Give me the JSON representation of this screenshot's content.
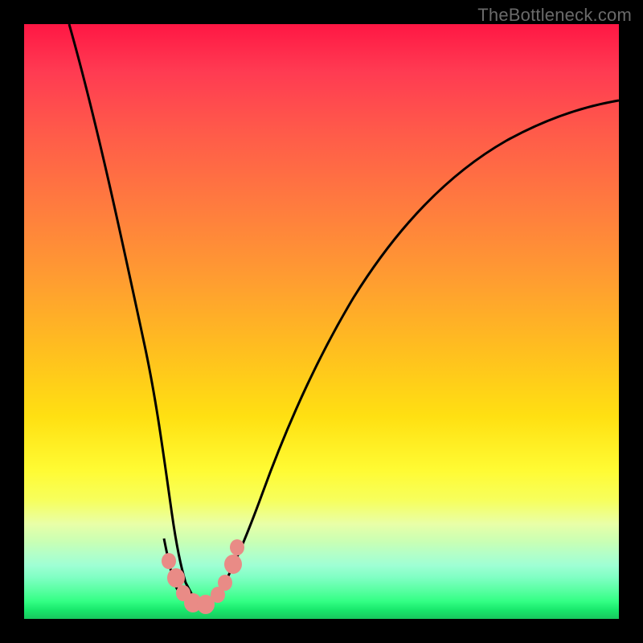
{
  "watermark": "TheBottleneck.com",
  "chart_data": {
    "type": "line",
    "title": "",
    "xlabel": "",
    "ylabel": "",
    "xlim": [
      0,
      1
    ],
    "ylim": [
      0,
      1
    ],
    "note": "Axes are unlabeled; x and y are approximate normalized positions read from the rendered plot. y=0 is the bottom (green) edge, y=1 is the top (red) edge.",
    "series": [
      {
        "name": "bottleneck-curve",
        "x": [
          0.0,
          0.05,
          0.1,
          0.14,
          0.18,
          0.21,
          0.235,
          0.26,
          0.285,
          0.31,
          0.33,
          0.36,
          0.395,
          0.44,
          0.5,
          0.57,
          0.65,
          0.74,
          0.84,
          0.94,
          1.0
        ],
        "y": [
          1.0,
          0.84,
          0.68,
          0.53,
          0.39,
          0.26,
          0.14,
          0.05,
          0.025,
          0.03,
          0.07,
          0.14,
          0.24,
          0.35,
          0.46,
          0.56,
          0.65,
          0.73,
          0.79,
          0.83,
          0.85
        ]
      },
      {
        "name": "markers",
        "x": [
          0.243,
          0.26,
          0.273,
          0.295,
          0.31,
          0.325,
          0.34
        ],
        "y": [
          0.095,
          0.055,
          0.035,
          0.03,
          0.035,
          0.065,
          0.11
        ]
      }
    ],
    "gradient_stops": [
      {
        "pos": 0.0,
        "color": "#18c85e"
      },
      {
        "pos": 0.015,
        "color": "#18e86c"
      },
      {
        "pos": 0.03,
        "color": "#34ff85"
      },
      {
        "pos": 0.05,
        "color": "#5cffa5"
      },
      {
        "pos": 0.07,
        "color": "#80ffc4"
      },
      {
        "pos": 0.09,
        "color": "#9fffd4"
      },
      {
        "pos": 0.11,
        "color": "#b4ffc7"
      },
      {
        "pos": 0.13,
        "color": "#c9ffb4"
      },
      {
        "pos": 0.16,
        "color": "#e9ffa7"
      },
      {
        "pos": 0.2,
        "color": "#f7ff5c"
      },
      {
        "pos": 0.25,
        "color": "#fffb33"
      },
      {
        "pos": 0.34,
        "color": "#ffe012"
      },
      {
        "pos": 0.45,
        "color": "#ffbf1f"
      },
      {
        "pos": 0.58,
        "color": "#ff9a32"
      },
      {
        "pos": 0.7,
        "color": "#ff7a3f"
      },
      {
        "pos": 0.82,
        "color": "#ff5a4a"
      },
      {
        "pos": 0.92,
        "color": "#ff3b52"
      },
      {
        "pos": 1.0,
        "color": "#ff1744"
      }
    ],
    "marker_color": "#e98b86",
    "curve_color": "#000000"
  }
}
